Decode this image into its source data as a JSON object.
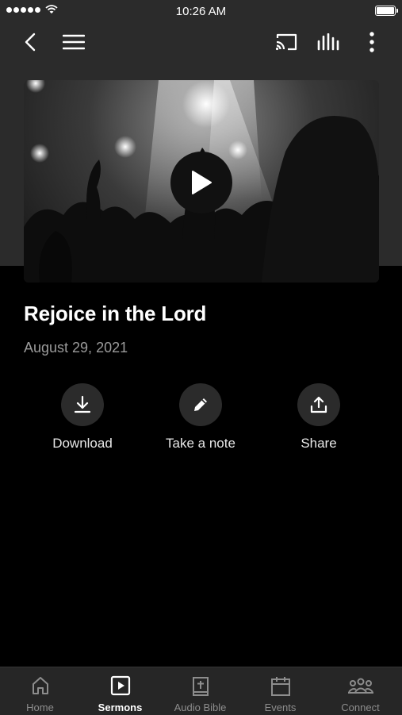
{
  "status_bar": {
    "time": "10:26 AM"
  },
  "header": {
    "icons": [
      "back-icon",
      "menu-icon",
      "cast-icon",
      "audio-bars-icon",
      "more-icon"
    ]
  },
  "sermon": {
    "title": "Rejoice in the Lord",
    "date": "August 29, 2021"
  },
  "actions": [
    {
      "label": "Download",
      "icon": "download-icon"
    },
    {
      "label": "Take a note",
      "icon": "pencil-icon"
    },
    {
      "label": "Share",
      "icon": "share-icon"
    }
  ],
  "tabs": [
    {
      "label": "Home",
      "icon": "home-icon",
      "active": false
    },
    {
      "label": "Sermons",
      "icon": "play-square-icon",
      "active": true
    },
    {
      "label": "Audio Bible",
      "icon": "bible-icon",
      "active": false
    },
    {
      "label": "Events",
      "icon": "calendar-icon",
      "active": false
    },
    {
      "label": "Connect",
      "icon": "people-icon",
      "active": false
    }
  ],
  "colors": {
    "background": "#000000",
    "header_bg": "#2b2b2b",
    "tab_bar_bg": "#262626",
    "date_text": "#9b9b9b"
  }
}
